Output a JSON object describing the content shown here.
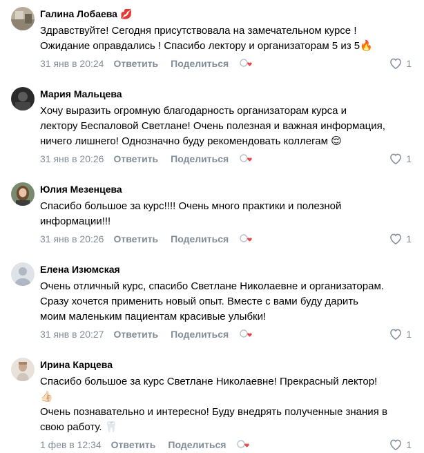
{
  "actions": {
    "reply": "Ответить",
    "share": "Поделиться"
  },
  "comments": [
    {
      "author": "Галина Лобаева",
      "author_emoji": "💋",
      "lines": [
        "Здравствуйте! Сегодня присутствовала на замечательном курсе !",
        "Ожидание оправдались ! Спасибо лектору и организаторам 5 из 5🔥"
      ],
      "date": "31 янв в 20:24",
      "likes": "1"
    },
    {
      "author": "Мария Мальцева",
      "lines": [
        "Хочу выразить огромную благодарность организаторам курса и",
        "лектору Беспаловой Светлане! Очень полезная и важная информация,",
        "ничего лишнего! Однозначно буду рекомендовать коллегам 😌"
      ],
      "date": "31 янв в 20:26",
      "likes": "1"
    },
    {
      "author": "Юлия Мезенцева",
      "lines": [
        "Спасибо большое за курс!!!! Очень много практики и полезной",
        "информации!!!"
      ],
      "date": "31 янв в 20:26",
      "likes": "1"
    },
    {
      "author": "Елена Изюмская",
      "lines": [
        "Очень отличный курс, спасибо Светлане Николаевне и организаторам.",
        "Сразу хочется применить новый опыт. Вместе с вами буду дарить",
        "моим маленьким пациентам красивые улыбки!"
      ],
      "date": "31 янв в 20:27",
      "likes": "1"
    },
    {
      "author": "Ирина Карцева",
      "lines": [
        "Спасибо большое за курс Светлане Николаевне! Прекрасный лектор!",
        "👍🏻",
        "Очень познавательно и интересно! Буду внедрять полученные знания в",
        "свою работу. 🦷"
      ],
      "date": "1 фев в 12:34",
      "likes": "1"
    }
  ],
  "colors": {
    "meta": "#818c99",
    "heart": "#e64646"
  }
}
